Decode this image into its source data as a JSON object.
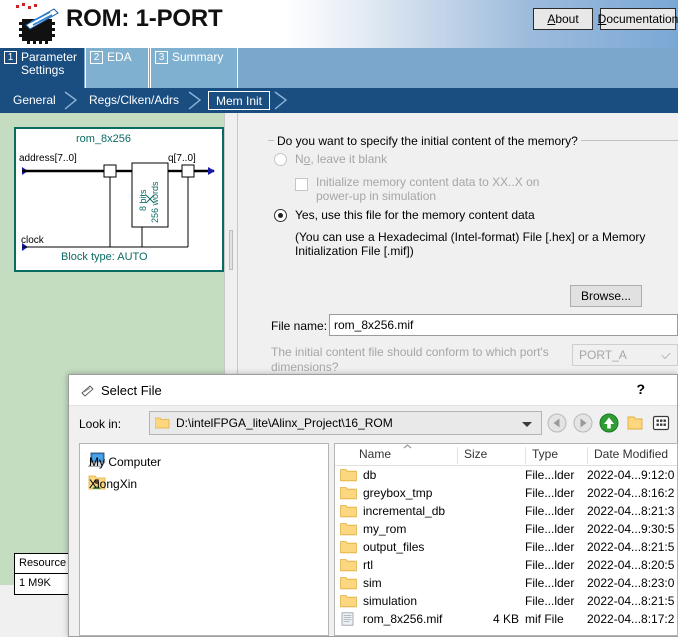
{
  "header": {
    "title": "ROM: 1-PORT",
    "icon": "chip-icon",
    "about_label": "About",
    "about_accel": "A",
    "about_rest": "bout",
    "doc_label": "Documentation",
    "doc_accel": "D",
    "doc_rest": "ocumentation"
  },
  "step_tabs": [
    {
      "num": "1",
      "label": "Parameter Settings",
      "selected": true
    },
    {
      "num": "2",
      "label": "EDA",
      "selected": false
    },
    {
      "num": "3",
      "label": "Summary",
      "selected": false
    }
  ],
  "sub_tabs": [
    {
      "label": "General",
      "selected": false
    },
    {
      "label": "Regs/Clken/Adrs",
      "selected": false
    },
    {
      "label": "Mem Init",
      "selected": true
    }
  ],
  "diagram": {
    "block_name": "rom_8x256",
    "port_address": "address[7..0]",
    "port_q": "q[7..0]",
    "port_clock": "clock",
    "memory_bits": "8 bits",
    "memory_words": "256 words",
    "block_type": "Block type: AUTO",
    "accent_color": "#0a6b63"
  },
  "resource": {
    "header": "Resource",
    "value": "1 M9K"
  },
  "options": {
    "group_title": "Do you want to specify the initial content of the memory?",
    "radio_no": {
      "prefix": "N",
      "accel": "o",
      "suffix": ", leave it blank",
      "checked": false,
      "disabled": true
    },
    "checkbox_init": {
      "label_line1": "Initialize memory content data to XX..X on",
      "label_line2": "power-up in simulation",
      "checked": false,
      "disabled": true
    },
    "radio_yes": {
      "label": "Yes, use this file for the memory content data",
      "checked": true,
      "disabled": false
    },
    "hint_line1": "(You can use a Hexadecimal (Intel-format) File [.hex] or a Memory",
    "hint_line2": "Initialization File [.mif])",
    "browse_label": "Browse...",
    "filename_label": "File name:",
    "filename_value": "rom_8x256.mif",
    "conform_line1": "The initial content file should conform to which port's",
    "conform_line2": "dimensions?",
    "port_value": "PORT_A"
  },
  "dialog": {
    "title": "Select File",
    "help_label": "?",
    "lookin_label": "Look in:",
    "lookin_path": "D:\\intelFPGA_lite\\Alinx_Project\\16_ROM",
    "toolbar": [
      {
        "name": "back-icon",
        "enabled": false
      },
      {
        "name": "forward-icon",
        "enabled": false
      },
      {
        "name": "up-icon",
        "enabled": true
      },
      {
        "name": "new-folder-icon",
        "enabled": true
      },
      {
        "name": "view-mode-icon",
        "enabled": true
      }
    ],
    "places": [
      {
        "label": "My Computer",
        "icon": "computer-icon"
      },
      {
        "label": "XiongXin",
        "icon": "user-folder-icon"
      }
    ],
    "columns": [
      "Name",
      "Size",
      "Type",
      "Date Modified"
    ],
    "sort_column": "Name",
    "sort_direction": "ascending",
    "files": [
      {
        "name": "db",
        "size": "",
        "type": "File...lder",
        "date": "2022-04...9:12:0",
        "icon": "folder-icon"
      },
      {
        "name": "greybox_tmp",
        "size": "",
        "type": "File...lder",
        "date": "2022-04...8:16:2",
        "icon": "folder-icon"
      },
      {
        "name": "incremental_db",
        "size": "",
        "type": "File...lder",
        "date": "2022-04...8:21:3",
        "icon": "folder-icon"
      },
      {
        "name": "my_rom",
        "size": "",
        "type": "File...lder",
        "date": "2022-04...9:30:5",
        "icon": "folder-icon"
      },
      {
        "name": "output_files",
        "size": "",
        "type": "File...lder",
        "date": "2022-04...8:21:5",
        "icon": "folder-icon"
      },
      {
        "name": "rtl",
        "size": "",
        "type": "File...lder",
        "date": "2022-04...8:20:5",
        "icon": "folder-icon"
      },
      {
        "name": "sim",
        "size": "",
        "type": "File...lder",
        "date": "2022-04...8:23:0",
        "icon": "folder-icon"
      },
      {
        "name": "simulation",
        "size": "",
        "type": "File...lder",
        "date": "2022-04...8:21:5",
        "icon": "folder-icon"
      },
      {
        "name": "rom_8x256.mif",
        "size": "4 KB",
        "type": "mif File",
        "date": "2022-04...8:17:2",
        "icon": "mif-file-icon"
      }
    ]
  },
  "colors": {
    "tab_active": "#1a4d80",
    "tab_inactive": "#7fb0cf",
    "strip": "#7ba7cd",
    "panel_green": "#c4dcc0",
    "diagram_teal": "#0a6b63"
  }
}
